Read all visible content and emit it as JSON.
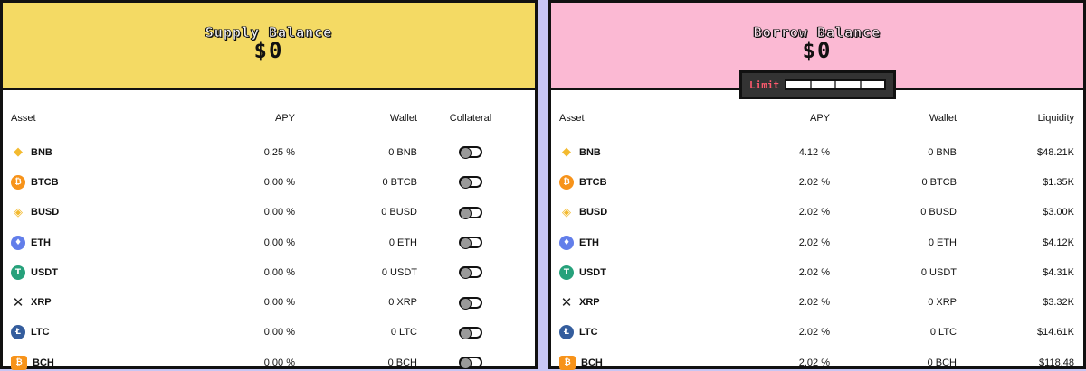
{
  "supply": {
    "title": "Supply Balance",
    "balance": "$0",
    "columns": {
      "asset": "Asset",
      "apy": "APY",
      "wallet": "Wallet",
      "collateral": "Collateral"
    },
    "rows": [
      {
        "icon": "bnb-icon",
        "asset": "BNB",
        "apy": "0.25 %",
        "wallet": "0 BNB",
        "collateral": false
      },
      {
        "icon": "btcb-icon",
        "asset": "BTCB",
        "apy": "0.00 %",
        "wallet": "0 BTCB",
        "collateral": false
      },
      {
        "icon": "busd-icon",
        "asset": "BUSD",
        "apy": "0.00 %",
        "wallet": "0 BUSD",
        "collateral": false
      },
      {
        "icon": "eth-icon",
        "asset": "ETH",
        "apy": "0.00 %",
        "wallet": "0 ETH",
        "collateral": false
      },
      {
        "icon": "usdt-icon",
        "asset": "USDT",
        "apy": "0.00 %",
        "wallet": "0 USDT",
        "collateral": false
      },
      {
        "icon": "xrp-icon",
        "asset": "XRP",
        "apy": "0.00 %",
        "wallet": "0 XRP",
        "collateral": false
      },
      {
        "icon": "ltc-icon",
        "asset": "LTC",
        "apy": "0.00 %",
        "wallet": "0 LTC",
        "collateral": false
      },
      {
        "icon": "bch-icon",
        "asset": "BCH",
        "apy": "0.00 %",
        "wallet": "0 BCH",
        "collateral": false
      }
    ]
  },
  "borrow": {
    "title": "Borrow Balance",
    "balance": "$0",
    "limit_label": "Limit",
    "limit_used": 0,
    "columns": {
      "asset": "Asset",
      "apy": "APY",
      "wallet": "Wallet",
      "liquidity": "Liquidity"
    },
    "rows": [
      {
        "icon": "bnb-icon",
        "asset": "BNB",
        "apy": "4.12 %",
        "wallet": "0 BNB",
        "liquidity": "$48.21K"
      },
      {
        "icon": "btcb-icon",
        "asset": "BTCB",
        "apy": "2.02 %",
        "wallet": "0 BTCB",
        "liquidity": "$1.35K"
      },
      {
        "icon": "busd-icon",
        "asset": "BUSD",
        "apy": "2.02 %",
        "wallet": "0 BUSD",
        "liquidity": "$3.00K"
      },
      {
        "icon": "eth-icon",
        "asset": "ETH",
        "apy": "2.02 %",
        "wallet": "0 ETH",
        "liquidity": "$4.12K"
      },
      {
        "icon": "usdt-icon",
        "asset": "USDT",
        "apy": "2.02 %",
        "wallet": "0 USDT",
        "liquidity": "$4.31K"
      },
      {
        "icon": "xrp-icon",
        "asset": "XRP",
        "apy": "2.02 %",
        "wallet": "0 XRP",
        "liquidity": "$3.32K"
      },
      {
        "icon": "ltc-icon",
        "asset": "LTC",
        "apy": "2.02 %",
        "wallet": "0 LTC",
        "liquidity": "$14.61K"
      },
      {
        "icon": "bch-icon",
        "asset": "BCH",
        "apy": "2.02 %",
        "wallet": "0 BCH",
        "liquidity": "$118.48"
      }
    ]
  },
  "colors": {
    "supply_header": "#f4da64",
    "borrow_header": "#fbb9d3",
    "page_bg": "#c8c6f4",
    "limit_text": "#ff5a6e"
  }
}
